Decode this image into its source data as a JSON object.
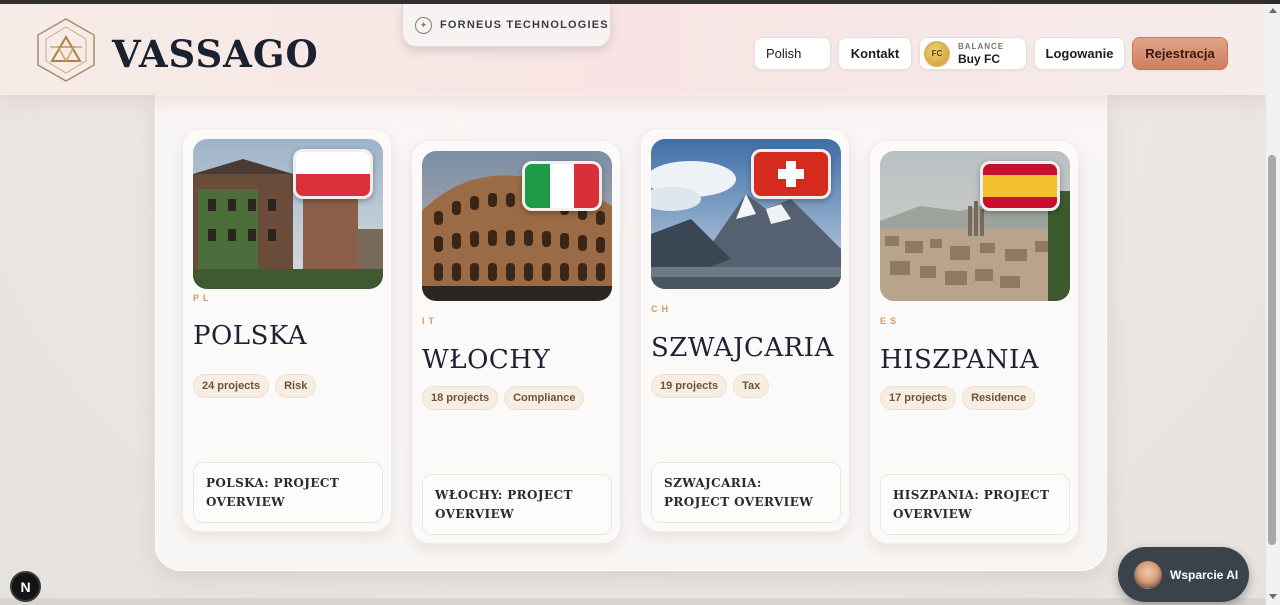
{
  "header": {
    "brand": "VASSAGO",
    "company_tab": "FORNEUS TECHNOLOGIES",
    "language": "Polish",
    "contact": "Kontakt",
    "balance_caption": "BALANCE",
    "balance_action": "Buy FC",
    "coin_label": "FC",
    "login": "Logowanie",
    "register": "Rejestracja"
  },
  "cards": [
    {
      "code": "PL",
      "name": "POLSKA",
      "tags": [
        "24 projects",
        "Risk"
      ],
      "overview": "POLSKA: PROJECT OVERVIEW"
    },
    {
      "code": "IT",
      "name": "WŁOCHY",
      "tags": [
        "18 projects",
        "Compliance"
      ],
      "overview": "WŁOCHY: PROJECT OVERVIEW"
    },
    {
      "code": "CH",
      "name": "SZWAJCARIA",
      "tags": [
        "19 projects",
        "Tax"
      ],
      "overview": "SZWAJCARIA: PROJECT OVERVIEW"
    },
    {
      "code": "ES",
      "name": "HISZPANIA",
      "tags": [
        "17 projects",
        "Residence"
      ],
      "overview": "HISZPANIA: PROJECT OVERVIEW"
    }
  ],
  "widgets": {
    "n_badge": "N",
    "support": "Wsparcie AI"
  },
  "colors": {
    "accent": "#cd7f62",
    "code_label": "#d69a64",
    "navy_text": "#1b2334"
  }
}
